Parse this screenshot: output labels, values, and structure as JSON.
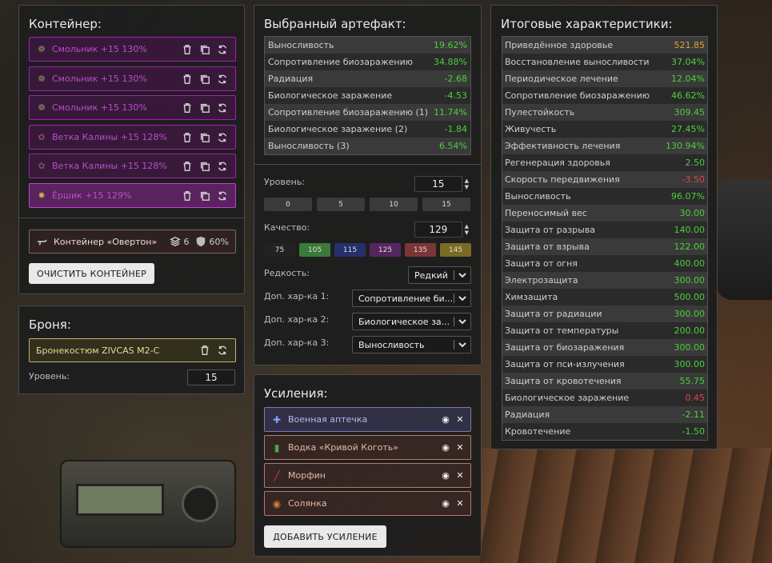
{
  "container": {
    "title": "Контейнер:",
    "artifacts": [
      {
        "label": "Смольник +15 130%",
        "icon": "smolnik-icon"
      },
      {
        "label": "Смольник +15 130%",
        "icon": "smolnik-icon"
      },
      {
        "label": "Смольник +15 130%",
        "icon": "smolnik-icon"
      },
      {
        "label": "Ветка Калины +15 128%",
        "icon": "kalina-branch-icon"
      },
      {
        "label": "Ветка Калины +15 128%",
        "icon": "kalina-branch-icon"
      },
      {
        "label": "Ёршик +15 129%",
        "icon": "yorshik-icon"
      }
    ],
    "slot": {
      "label": "Контейнер «Овертон»",
      "capacity": "6",
      "protection": "60%"
    },
    "clear_label": "ОЧИСТИТЬ КОНТЕЙНЕР"
  },
  "armor": {
    "title": "Броня:",
    "name": "Бронекостюм ZIVCAS M2-C",
    "level_label": "Уровень:",
    "level_value": "15"
  },
  "artifact": {
    "title": "Выбранный артефакт:",
    "stats": [
      {
        "name": "Выносливость",
        "value": "19.62%",
        "color": "green"
      },
      {
        "name": "Сопротивление биозаражению",
        "value": "34.88%",
        "color": "green"
      },
      {
        "name": "Радиация",
        "value": "-2.68",
        "color": "green"
      },
      {
        "name": "Биологическое заражение",
        "value": "-4.53",
        "color": "green"
      },
      {
        "name": "Сопротивление биозаражению (1)",
        "value": "11.74%",
        "color": "green"
      },
      {
        "name": "Биологическое заражение (2)",
        "value": "-1.84",
        "color": "green"
      },
      {
        "name": "Выносливость (3)",
        "value": "6.54%",
        "color": "green"
      }
    ],
    "level_label": "Уровень:",
    "level_value": "15",
    "level_presets": [
      "0",
      "5",
      "10",
      "15"
    ],
    "quality_label": "Качество:",
    "quality_value": "129",
    "quality_presets": [
      {
        "label": "75",
        "color": "#222222"
      },
      {
        "label": "105",
        "color": "#3a7a3a"
      },
      {
        "label": "115",
        "color": "#25306a"
      },
      {
        "label": "125",
        "color": "#55265e"
      },
      {
        "label": "135",
        "color": "#7a3636"
      },
      {
        "label": "145",
        "color": "#7a6a22"
      }
    ],
    "rarity_label": "Редкость:",
    "rarity_value": "Редкий",
    "extra1_label": "Доп. хар-ка 1:",
    "extra1_value": "Сопротивление би...",
    "extra2_label": "Доп. хар-ка 2:",
    "extra2_value": "Биологическое за...",
    "extra3_label": "Доп. хар-ка 3:",
    "extra3_value": "Выносливость"
  },
  "boosts": {
    "title": "Усиления:",
    "items": [
      {
        "label": "Военная аптечка",
        "icon": "military-medkit-icon"
      },
      {
        "label": "Водка «Кривой Коготь»",
        "icon": "vodka-bottle-icon"
      },
      {
        "label": "Морфин",
        "icon": "syringe-icon"
      },
      {
        "label": "Солянка",
        "icon": "soup-can-icon"
      }
    ],
    "add_label": "ДОБАВИТЬ УСИЛЕНИЕ"
  },
  "totals": {
    "title": "Итоговые характеристики:",
    "stats": [
      {
        "name": "Приведённое здоровье",
        "value": "521.85",
        "color": "orange"
      },
      {
        "name": "Восстановление выносливости",
        "value": "37.04%",
        "color": "green"
      },
      {
        "name": "Периодическое лечение",
        "value": "12.04%",
        "color": "green"
      },
      {
        "name": "Сопротивление биозаражению",
        "value": "46.62%",
        "color": "green"
      },
      {
        "name": "Пулестойкость",
        "value": "309.45",
        "color": "green"
      },
      {
        "name": "Живучесть",
        "value": "27.45%",
        "color": "green"
      },
      {
        "name": "Эффективность лечения",
        "value": "130.94%",
        "color": "green"
      },
      {
        "name": "Регенерация здоровья",
        "value": "2.50",
        "color": "green"
      },
      {
        "name": "Скорость передвижения",
        "value": "-3.50",
        "color": "red"
      },
      {
        "name": "Выносливость",
        "value": "96.07%",
        "color": "green"
      },
      {
        "name": "Переносимый вес",
        "value": "30.00",
        "color": "green"
      },
      {
        "name": "Защита от разрыва",
        "value": "140.00",
        "color": "green"
      },
      {
        "name": "Защита от взрыва",
        "value": "122.00",
        "color": "green"
      },
      {
        "name": "Защита от огня",
        "value": "400.00",
        "color": "green"
      },
      {
        "name": "Электрозащита",
        "value": "300.00",
        "color": "green"
      },
      {
        "name": "Химзащита",
        "value": "500.00",
        "color": "green"
      },
      {
        "name": "Защита от радиации",
        "value": "300.00",
        "color": "green"
      },
      {
        "name": "Защита от температуры",
        "value": "200.00",
        "color": "green"
      },
      {
        "name": "Защита от биозаражения",
        "value": "300.00",
        "color": "green"
      },
      {
        "name": "Защита от пси-излучения",
        "value": "300.00",
        "color": "green"
      },
      {
        "name": "Защита от кровотечения",
        "value": "55.75",
        "color": "green"
      },
      {
        "name": "Биологическое заражение",
        "value": "0.45",
        "color": "red"
      },
      {
        "name": "Радиация",
        "value": "-2.11",
        "color": "green"
      },
      {
        "name": "Кровотечение",
        "value": "-1.50",
        "color": "green"
      }
    ]
  }
}
